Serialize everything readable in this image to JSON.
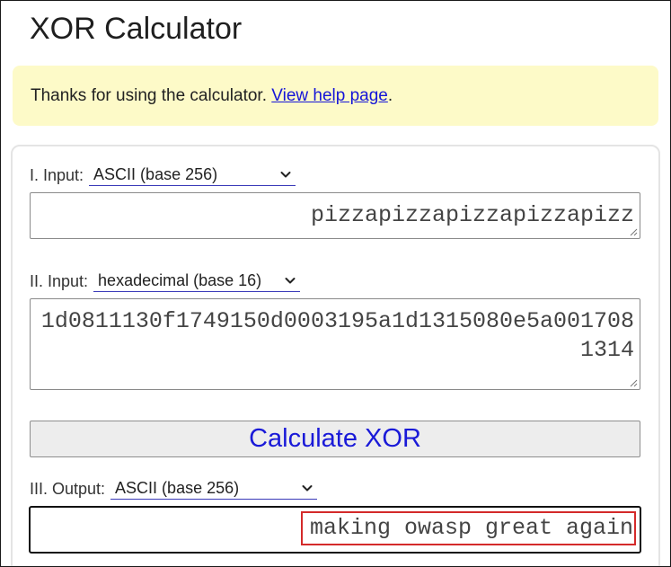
{
  "page": {
    "title": "XOR Calculator"
  },
  "notice": {
    "text": "Thanks for using the calculator. ",
    "link_label": "View help page",
    "suffix": ".",
    "background": "#fdfac8",
    "link_color": "#1515d8"
  },
  "input1": {
    "label": "I. Input:",
    "format_selected": "ASCII (base 256)",
    "value": "pizzapizzapizzapizzapizz"
  },
  "input2": {
    "label": "II. Input:",
    "format_selected": "hexadecimal (base 16)",
    "value": "1d0811130f1749150d0003195a1d1315080e5a0017081314"
  },
  "calculate": {
    "label": "Calculate XOR",
    "text_color": "#1a1ad8"
  },
  "output": {
    "label": "III. Output:",
    "format_selected": "ASCII (base 256)",
    "value": "making owasp great again",
    "highlight_color": "#d42a2a"
  },
  "icons": {
    "dropdown": "chevron-down-icon",
    "resize": "resize-grip-icon"
  }
}
